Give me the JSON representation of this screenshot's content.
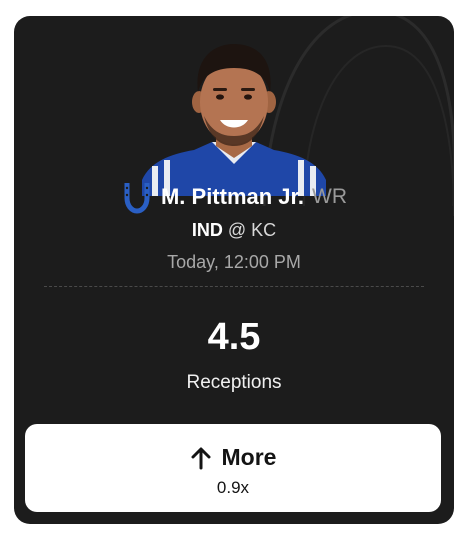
{
  "player": {
    "name": "M. Pittman Jr.",
    "position": "WR",
    "team_logo_icon": "horseshoe-icon"
  },
  "game": {
    "team": "IND",
    "separator": "@",
    "opponent": "KC",
    "time": "Today, 12:00 PM"
  },
  "projection": {
    "line": "4.5",
    "stat": "Receptions"
  },
  "pick": {
    "label": "More",
    "icon": "arrow-up-icon",
    "multiplier": "0.9x"
  },
  "colors": {
    "card_bg": "#1c1c1c",
    "jersey": "#1f47a8",
    "logo": "#2a5fc4",
    "button_bg": "#ffffff"
  }
}
